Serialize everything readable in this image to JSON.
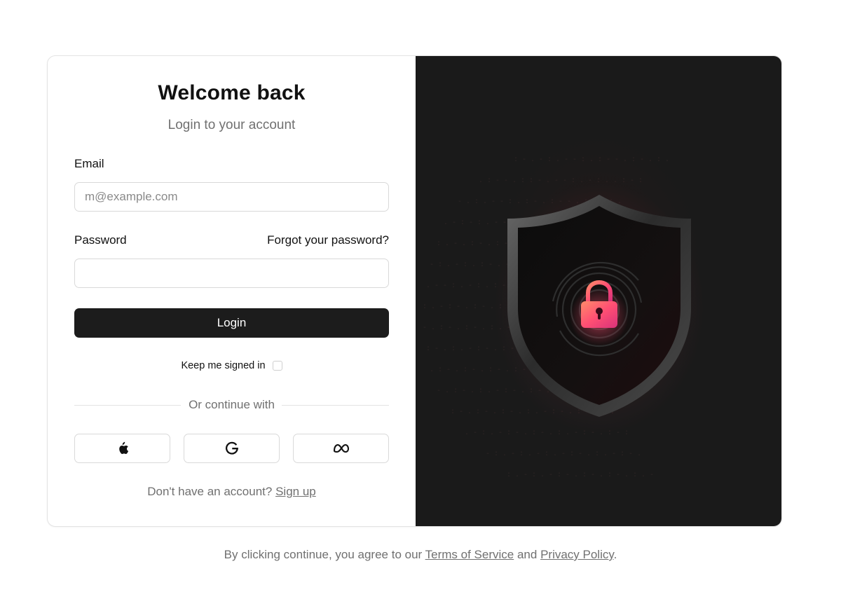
{
  "login": {
    "title": "Welcome back",
    "subtitle": "Login to your account",
    "email_label": "Email",
    "email_placeholder": "m@example.com",
    "email_value": "",
    "password_label": "Password",
    "forgot_link": "Forgot your password?",
    "password_value": "",
    "login_button": "Login",
    "keep_signed_in_label": "Keep me signed in",
    "keep_signed_in_checked": false,
    "divider_text": "Or continue with",
    "social_buttons": [
      {
        "provider": "Apple",
        "icon": "apple-icon"
      },
      {
        "provider": "Google",
        "icon": "google-icon"
      },
      {
        "provider": "Meta",
        "icon": "meta-icon"
      }
    ],
    "signup_prompt": "Don't have an account?",
    "signup_link": "Sign up"
  },
  "illustration": {
    "icon": "shield-lock-fingerprint-icon",
    "background_color": "#1a1a1a",
    "accent_color": "#ff4f73"
  },
  "footer": {
    "prefix": "By clicking continue, you agree to our",
    "terms_link": "Terms of Service",
    "conjunction": "and",
    "privacy_link": "Privacy Policy",
    "suffix": "."
  }
}
